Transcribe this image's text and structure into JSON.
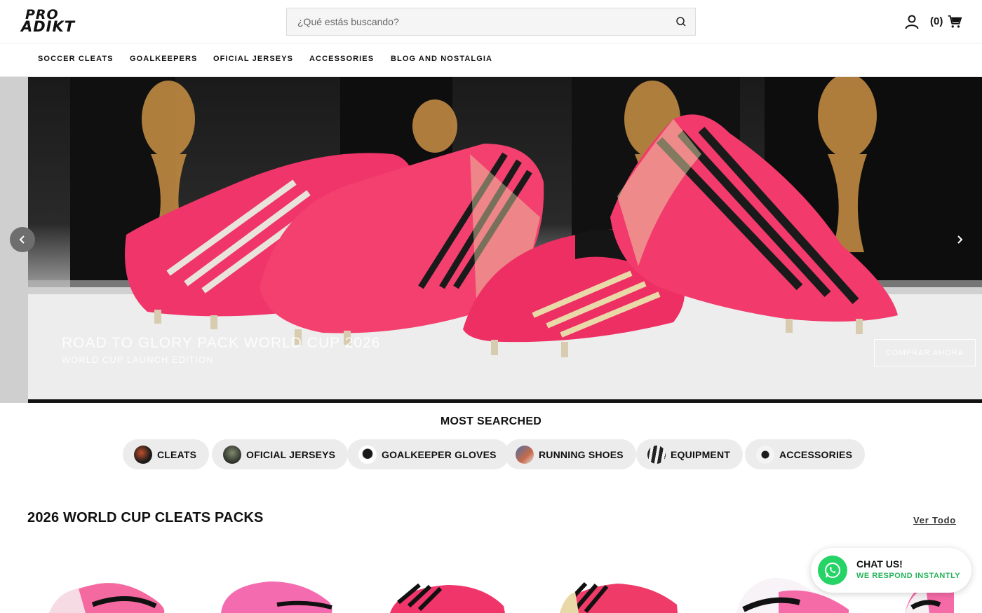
{
  "brand": {
    "logo_line1": "PRO",
    "logo_line2": "ADIKT"
  },
  "search": {
    "placeholder": "¿Qué estás buscando?"
  },
  "header": {
    "cart_count": "(0)",
    "user_icon": "user-icon",
    "cart_icon": "cart-icon"
  },
  "nav": {
    "items": [
      "SOCCER CLEATS",
      "GOALKEEPERS",
      "OFICIAL JERSEYS",
      "ACCESSORIES",
      "BLOG AND NOSTALGIA"
    ]
  },
  "hero": {
    "title": "ROAD TO GLORY PACK WORLD CUP 2026",
    "subtitle": "WORLD CUP LAUNCH EDITION",
    "cta_label": "COMPRAR AHORA",
    "shoe_colors": {
      "primary": "#f0356a",
      "stripes": "#1a1a1a",
      "accent": "#e9d9a8"
    }
  },
  "most_searched": {
    "title": "MOST SEARCHED",
    "chips": [
      "CLEATS",
      "OFICIAL JERSEYS",
      "GOALKEEPER GLOVES",
      "RUNNING SHOES",
      "EQUIPMENT",
      "ACCESSORIES"
    ]
  },
  "section": {
    "title": "2026 WORLD CUP CLEATS PACKS",
    "view_all": "Ver Todo"
  },
  "chat": {
    "title": "CHAT US!",
    "subtitle": "WE RESPOND INSTANTLY",
    "color": "#25d366"
  }
}
